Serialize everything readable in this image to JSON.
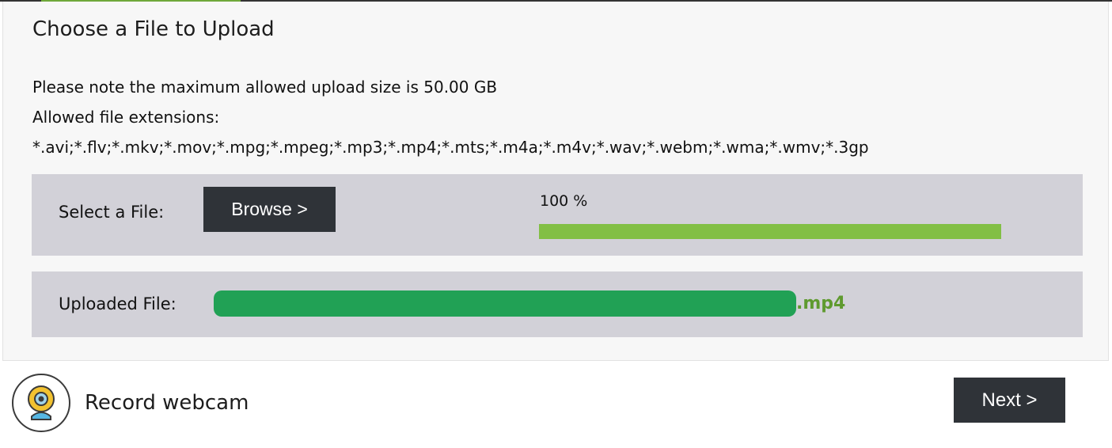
{
  "panel": {
    "title": "Choose a File to Upload",
    "notes": [
      "Please note the maximum allowed upload size is 50.00 GB",
      "Allowed file extensions:",
      "*.avi;*.flv;*.mkv;*.mov;*.mpg;*.mpeg;*.mp3;*.mp4;*.mts;*.m4a;*.m4v;*.wav;*.webm;*.wma;*.wmv;*.3gp"
    ]
  },
  "select_row": {
    "label": "Select a File:",
    "browse_label": "Browse >",
    "progress_text": "100 %",
    "progress_fraction": 1.0
  },
  "uploaded_row": {
    "label": "Uploaded File:",
    "file_extension": ".mp4"
  },
  "webcam": {
    "icon": "webcam-icon",
    "label": "Record webcam"
  },
  "footer": {
    "next_label": "Next  >"
  },
  "colors": {
    "progress_fill": "#82bf45",
    "redaction": "#21a155",
    "extension_text": "#5f9a2f",
    "button_bg": "#2f3338",
    "row_bg": "#d2d1d8"
  }
}
